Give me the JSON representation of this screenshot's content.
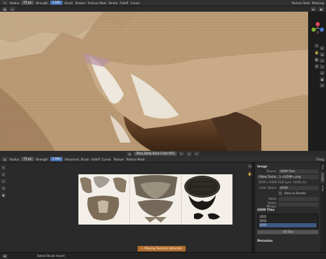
{
  "top_toolbar": {
    "radius_label": "Radius",
    "radius_value": "75 px",
    "strength_label": "Strength",
    "strength_value": "1.000",
    "menus": [
      "Brush",
      "Texture",
      "Texture Mask",
      "Stroke",
      "Falloff",
      "Cursor"
    ],
    "right_menus": [
      "Texture Slots",
      "Masking"
    ]
  },
  "mid_bar": {
    "image_name": "Blue_Body Base Color 001"
  },
  "uv_header": {
    "radius_label": "Radius",
    "radius_value": "75 px",
    "strength_label": "Strength",
    "strength_value": "1.000",
    "menus": [
      "Advanced",
      "Brush",
      "Falloff",
      "Cursor",
      "Texture",
      "Texture Mask"
    ],
    "tiling": "Tiling"
  },
  "side_panel": {
    "image_section": "Image",
    "source_label": "Source",
    "source_value": "UDIM Tiles",
    "file_value": "//New Textur...1.<UDIM>.png",
    "info_value": "8096 x 8096  RGB byte  .UDIM_tile",
    "color_space_label": "Color Space",
    "color_space_value": "sRGB",
    "view_as_render": "View as Render",
    "alpha_label": "Alpha",
    "sequence_label": "Space Margin",
    "udim_section": "UDIM Tiles",
    "tiles": [
      "1001",
      "1002",
      "1003"
    ],
    "fill_button": "Fill Tile",
    "metadata_section": "Metadata"
  },
  "side_tabs": [
    "Tool",
    "Image",
    "View"
  ],
  "status_bar": {
    "left_text": "Select Brush Invert",
    "warning_text": "Missing Textures detected"
  },
  "colors": {
    "accent_blue": "#4772b3",
    "warning_orange": "#b06a2a",
    "panel_bg": "#2c2c2c"
  }
}
